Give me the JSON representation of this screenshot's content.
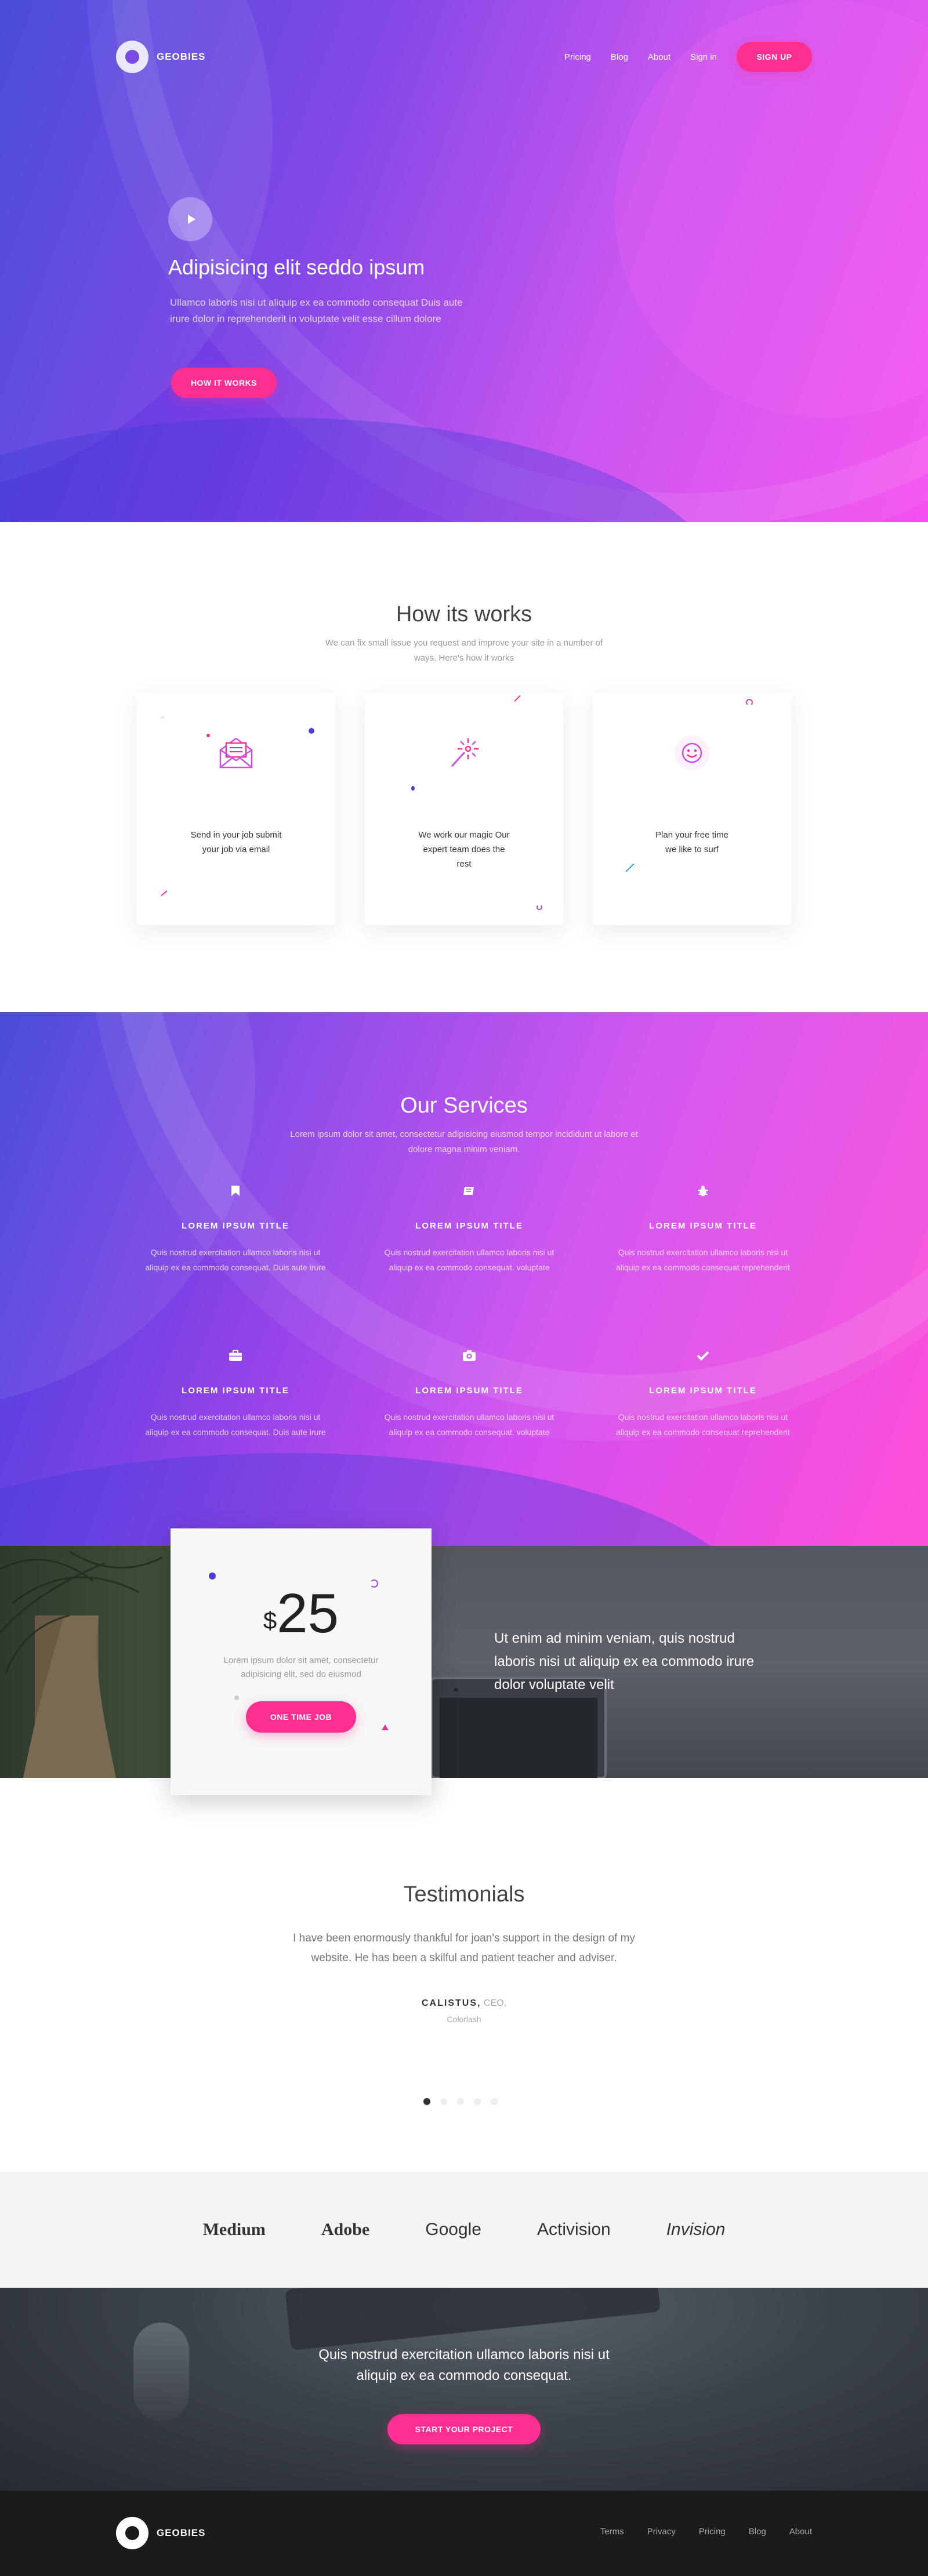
{
  "brand": {
    "name": "GEOBIES"
  },
  "nav": {
    "links": [
      "Pricing",
      "Blog",
      "About",
      "Sign in"
    ],
    "signup": "SIGN UP"
  },
  "hero": {
    "title": "Adipisicing elit seddo ipsum",
    "lead": "Ullamco laboris nisi ut aliquip ex ea commodo consequat Duis aute irure dolor in reprehenderit in voluptate velit esse cillum dolore",
    "cta": "HOW IT WORKS"
  },
  "how": {
    "title": "How its works",
    "subtitle": "We can fix small issue you request and improve your site in a number of ways. Here's how it works",
    "cards": [
      {
        "icon": "envelope-icon",
        "text": "Send in your job submit your job via email"
      },
      {
        "icon": "magic-wand-icon",
        "text": "We work our magic Our expert team does the rest"
      },
      {
        "icon": "smiley-icon",
        "text": "Plan your free time we like to surf"
      }
    ]
  },
  "services": {
    "title": "Our Services",
    "subtitle": "Lorem ipsum dolor sit amet, consectetur adipisicing eiusmod tempor incididunt ut labore et dolore magna minim veniam.",
    "items": [
      {
        "icon": "bookmark-icon",
        "title": "LOREM IPSUM TITLE",
        "text": "Quis nostrud exercitation ullamco laboris nisi ut aliquip ex ea commodo consequat. Duis aute irure"
      },
      {
        "icon": "book-icon",
        "title": "LOREM IPSUM TITLE",
        "text": "Quis nostrud exercitation ullamco laboris nisi ut aliquip ex ea commodo consequat. voluptate"
      },
      {
        "icon": "bug-icon",
        "title": "LOREM IPSUM TITLE",
        "text": "Quis nostrud exercitation ullamco laboris nisi ut aliquip ex ea commodo consequat reprehenderit"
      },
      {
        "icon": "briefcase-icon",
        "title": "LOREM IPSUM TITLE",
        "text": "Quis nostrud exercitation ullamco laboris nisi ut aliquip ex ea commodo consequat. Duis aute irure"
      },
      {
        "icon": "camera-icon",
        "title": "LOREM IPSUM TITLE",
        "text": "Quis nostrud exercitation ullamco laboris nisi ut aliquip ex ea commodo consequat. voluptate"
      },
      {
        "icon": "check-icon",
        "title": "LOREM IPSUM TITLE",
        "text": "Quis nostrud exercitation ullamco laboris nisi ut aliquip ex ea commodo consequat reprehenderit"
      }
    ]
  },
  "pricing": {
    "currency": "$",
    "amount": "25",
    "text": "Lorem ipsum dolor sit amet, consectetur adipisicing elit, sed do eiusmod",
    "cta": "ONE TIME JOB",
    "quote": "Ut enim ad minim veniam, quis nostrud laboris nisi ut aliquip ex ea commodo irure dolor voluptate velit"
  },
  "testimonials": {
    "title": "Testimonials",
    "quote": "I have been enormously thankful for joan's support in the design of my website. He has been a skilful and patient teacher and adviser.",
    "author": "CALISTUS,",
    "role": "CEO,",
    "company": "Colorlash",
    "pages": 5,
    "active_page": 1
  },
  "logos": [
    "Medium",
    "Adobe",
    "Google",
    "Activision",
    "Invision"
  ],
  "cta": {
    "text": "Quis nostrud exercitation ullamco laboris nisi ut aliquip ex ea commodo consequat.",
    "button": "START YOUR PROJECT"
  },
  "footer": {
    "links": [
      "Terms",
      "Privacy",
      "Pricing",
      "Blog",
      "About"
    ]
  },
  "colors": {
    "accent": "#ff2f92",
    "gradient_start": "#3c40d8",
    "gradient_end": "#f54ff0",
    "footer_bg": "#1b1b1b"
  }
}
